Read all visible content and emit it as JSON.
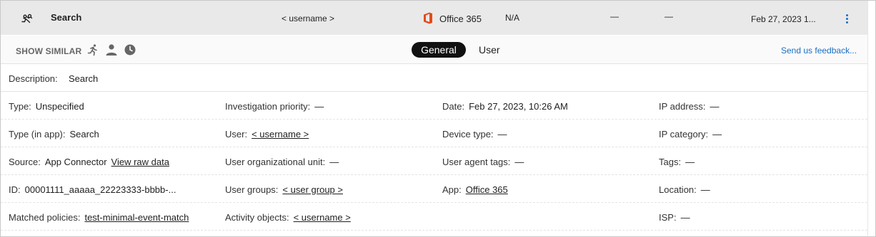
{
  "summary": {
    "activity": "Search",
    "user": "< username >",
    "app": "Office 365",
    "na": "N/A",
    "dash1": "—",
    "dash2": "—",
    "date": "Feb 27, 2023 1...",
    "icons": {
      "activity": "search-activity-icon",
      "app": "office365-icon",
      "more": "more-options-icon"
    },
    "colors": {
      "office": "#e64a19",
      "accent": "#1a6fc4"
    }
  },
  "toolbar": {
    "show_similar": "SHOW SIMILAR",
    "icons": [
      "run-icon",
      "person-icon",
      "clock-icon"
    ],
    "tabs": [
      {
        "label": "General",
        "selected": true
      },
      {
        "label": "User",
        "selected": false
      }
    ],
    "feedback": "Send us feedback..."
  },
  "details": {
    "description": {
      "label": "Description:",
      "value": "Search"
    },
    "rows": [
      [
        {
          "label": "Type:",
          "value": "Unspecified"
        },
        {
          "label": "Investigation priority:",
          "value": "—"
        },
        {
          "label": "Date:",
          "value": "Feb 27, 2023, 10:26 AM"
        },
        {
          "label": "IP address:",
          "value": "—"
        }
      ],
      [
        {
          "label": "Type (in app):",
          "value": "Search"
        },
        {
          "label": "User:",
          "value": "< username >"
        },
        {
          "label": "Device type:",
          "value": "—"
        },
        {
          "label": "IP category:",
          "value": "—"
        }
      ],
      [
        {
          "label": "Source:",
          "value": "App Connector",
          "link": "View raw data"
        },
        {
          "label": "User organizational unit:",
          "value": "—"
        },
        {
          "label": "User agent tags:",
          "value": "—"
        },
        {
          "label": "Tags:",
          "value": "—"
        }
      ],
      [
        {
          "label": "ID:",
          "value": "00001111_aaaaa_22223333-bbbb-..."
        },
        {
          "label": "User groups:",
          "value": "< user group >"
        },
        {
          "label": "App:",
          "value": "Office 365"
        },
        {
          "label": "Location:",
          "value": "—"
        }
      ],
      [
        {
          "label": "Matched policies:",
          "value": "test-minimal-event-match"
        },
        {
          "label": "Activity objects:",
          "value": "< username >"
        },
        {
          "label": "",
          "value": ""
        },
        {
          "label": "ISP:",
          "value": "—"
        }
      ]
    ]
  }
}
